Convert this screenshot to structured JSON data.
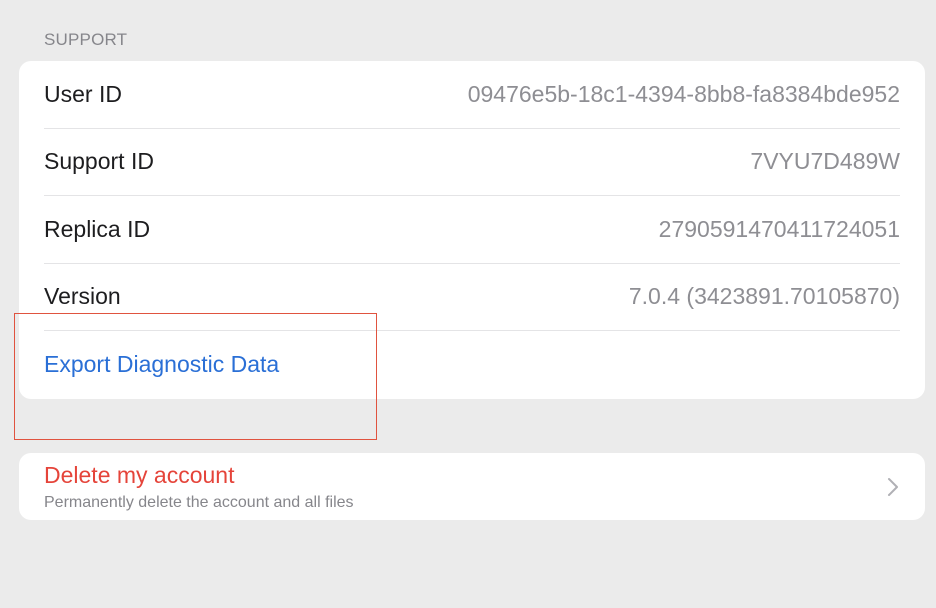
{
  "support": {
    "header": "SUPPORT",
    "rows": [
      {
        "label": "User ID",
        "value": "09476e5b-18c1-4394-8bb8-fa8384bde952"
      },
      {
        "label": "Support ID",
        "value": "7VYU7D489W"
      },
      {
        "label": "Replica ID",
        "value": "2790591470411724051"
      },
      {
        "label": "Version",
        "value": "7.0.4 (3423891.70105870)"
      }
    ],
    "export_label": "Export Diagnostic Data"
  },
  "account": {
    "delete_title": "Delete my account",
    "delete_subtitle": "Permanently delete the account and all files"
  },
  "colors": {
    "link": "#2a6fd6",
    "destructive": "#e5443a",
    "highlight_box": "#e0533f"
  }
}
